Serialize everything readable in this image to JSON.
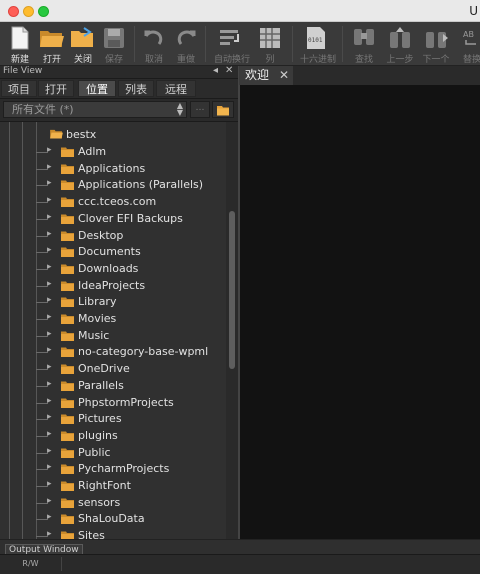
{
  "window": {
    "title": "U"
  },
  "toolbar": {
    "buttons": [
      {
        "label": "新建",
        "icon": "new-file-icon"
      },
      {
        "label": "打开",
        "icon": "open-folder-icon"
      },
      {
        "label": "关闭",
        "icon": "close-folder-icon"
      },
      {
        "label": "保存",
        "icon": "save-icon"
      },
      {
        "label": "取消",
        "icon": "undo-icon"
      },
      {
        "label": "重做",
        "icon": "redo-icon"
      },
      {
        "label": "自动换行",
        "icon": "word-wrap-icon"
      },
      {
        "label": "列",
        "icon": "column-mode-icon"
      },
      {
        "label": "十六进制",
        "icon": "hex-mode-icon",
        "icon_text": "0101"
      },
      {
        "label": "查找",
        "icon": "find-icon"
      },
      {
        "label": "上一步",
        "icon": "find-prev-icon"
      },
      {
        "label": "下一个",
        "icon": "find-next-icon"
      },
      {
        "label": "替换",
        "icon": "replace-icon",
        "icon_text": "AB"
      }
    ]
  },
  "file_view": {
    "title": "File View",
    "tabs": [
      "项目",
      "打开",
      "位置",
      "列表",
      "远程"
    ],
    "active_tab": "位置",
    "filter": {
      "value": "所有文件 (*)"
    },
    "tree": {
      "root": "bestx",
      "items": [
        "Adlm",
        "Applications",
        "Applications (Parallels)",
        "ccc.tceos.com",
        "Clover EFI Backups",
        "Desktop",
        "Documents",
        "Downloads",
        "IdeaProjects",
        "Library",
        "Movies",
        "Music",
        "no-category-base-wpml",
        "OneDrive",
        "Parallels",
        "PhpstormProjects",
        "Pictures",
        "plugins",
        "Public",
        "PycharmProjects",
        "RightFont",
        "sensors",
        "ShaLouData",
        "Sites"
      ]
    }
  },
  "editor": {
    "tabs": [
      {
        "label": "欢迎"
      }
    ]
  },
  "bottom": {
    "output_window": "Output Window",
    "status_mode": "R/W"
  },
  "colors": {
    "folder": "#e8a33a",
    "panel_bg": "#303030",
    "editor_bg": "#121212"
  }
}
